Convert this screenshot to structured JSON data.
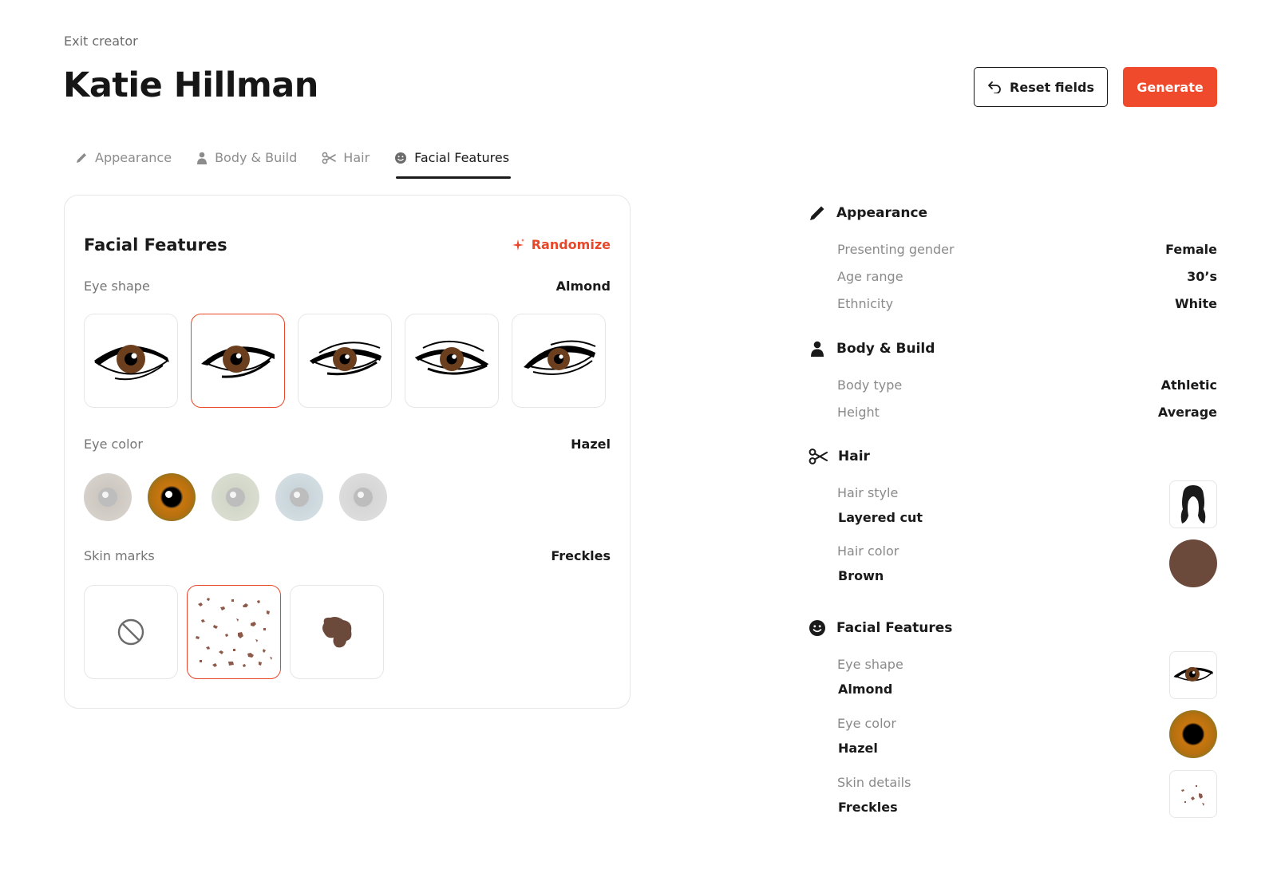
{
  "header": {
    "exit_label": "Exit creator",
    "title": "Katie Hillman",
    "reset_label": "Reset fields",
    "generate_label": "Generate"
  },
  "tabs": [
    {
      "label": "Appearance",
      "icon": "pencil-icon",
      "active": false
    },
    {
      "label": "Body & Build",
      "icon": "person-icon",
      "active": false
    },
    {
      "label": "Hair",
      "icon": "scissors-icon",
      "active": false
    },
    {
      "label": "Facial Features",
      "icon": "smiley-icon",
      "active": true
    }
  ],
  "panel": {
    "title": "Facial Features",
    "randomize_label": "Randomize",
    "eye_shape": {
      "label": "Eye shape",
      "value": "Almond",
      "options_count": 5,
      "selected_index": 1
    },
    "eye_color": {
      "label": "Eye color",
      "value": "Hazel",
      "options": [
        "#d6d0ca",
        "hazel",
        "#d8ddd0",
        "#d2dde2",
        "#dcdcdc"
      ],
      "selected_index": 1
    },
    "skin_marks": {
      "label": "Skin marks",
      "value": "Freckles",
      "options": [
        "none-icon",
        "freckles-icon",
        "birthmark-icon"
      ],
      "selected_index": 1
    }
  },
  "summary": {
    "appearance": {
      "title": "Appearance",
      "rows": [
        {
          "label": "Presenting gender",
          "value": "Female"
        },
        {
          "label": "Age range",
          "value": "30’s"
        },
        {
          "label": "Ethnicity",
          "value": "White"
        }
      ]
    },
    "body": {
      "title": "Body & Build",
      "rows": [
        {
          "label": "Body type",
          "value": "Athletic"
        },
        {
          "label": "Height",
          "value": "Average"
        }
      ]
    },
    "hair": {
      "title": "Hair",
      "style_label": "Hair style",
      "style_value": "Layered cut",
      "color_label": "Hair color",
      "color_value": "Brown",
      "color_hex": "#6b4a3c"
    },
    "facial": {
      "title": "Facial Features",
      "eye_shape_label": "Eye shape",
      "eye_shape_value": "Almond",
      "eye_color_label": "Eye color",
      "eye_color_value": "Hazel",
      "skin_label": "Skin details",
      "skin_value": "Freckles"
    }
  },
  "colors": {
    "accent": "#ef4a2b",
    "freckle": "#8c5a4a",
    "iris_brown": "#6b3f1d"
  }
}
